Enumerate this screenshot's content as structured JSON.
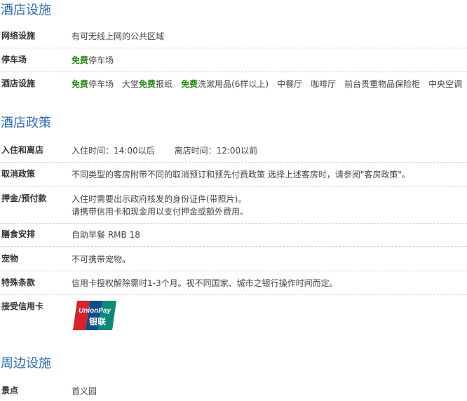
{
  "facilities": {
    "title": "酒店设施",
    "network": {
      "label": "网络设施",
      "value": "有可无线上网的公共区域"
    },
    "parking": {
      "label": "停车场",
      "free": "免费",
      "value": "停车场"
    },
    "hotel": {
      "label": "酒店设施",
      "free": "免费",
      "item1": "停车场",
      "item2_pre": "大堂",
      "item2_post": "报纸",
      "item3": "洗漱用品(6样以上)",
      "rest": "中餐厅　咖啡厅　前台贵重物品保险柜　中央空调"
    }
  },
  "policy": {
    "title": "酒店政策",
    "checkin": {
      "label": "入住和离店",
      "in": "入住时间：14:00以后",
      "out": "离店时间：12:00以前"
    },
    "cancel": {
      "label": "取消政策",
      "value": "不同类型的客房附带不同的取消预订和预先付费政策 选择上述客房时，请参阅\"客房政策\"。"
    },
    "deposit": {
      "label": "押金/预付款",
      "line1": "入住时需要出示政府核发的身份证件(带照片)。",
      "line2": "请携带信用卡和现金用以支付押金或额外费用。"
    },
    "meal": {
      "label": "膳食安排",
      "value": "自助早餐 RMB 18"
    },
    "pets": {
      "label": "宠物",
      "value": "不可携带宠物。"
    },
    "special": {
      "label": "特殊条款",
      "value": "信用卡授权解除需时1-3个月。视不同国家、城市之银行操作时间而定。"
    },
    "cards": {
      "label": "接受信用卡",
      "unionpay_en": "UnionPay",
      "unionpay_cn": "银联"
    }
  },
  "nearby": {
    "title": "周边设施",
    "scenic": {
      "label": "景点",
      "value": "首义园"
    }
  }
}
